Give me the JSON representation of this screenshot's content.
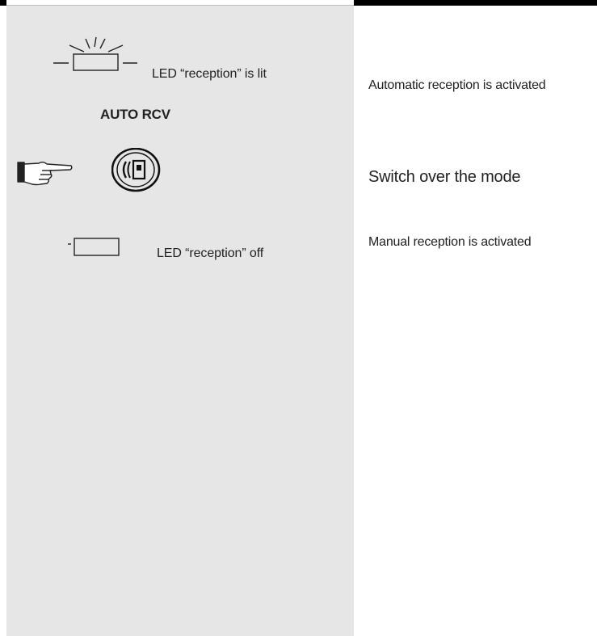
{
  "steps": [
    {
      "left_text": "LED “reception” is lit",
      "right_text": "Automatic reception is activated"
    },
    {
      "key_label": "AUTO RCV",
      "right_text": "Switch over the mode"
    },
    {
      "left_text": "LED “reception” off",
      "right_text": "Manual reception is activated"
    }
  ],
  "icons": {
    "led_lit": "led-lit-icon",
    "pointing_hand": "pointing-hand-icon",
    "auto_rcv_key": "phone-key-icon",
    "led_off": "led-off-icon"
  },
  "colors": {
    "left_panel_bg": "#e6e6e6",
    "text": "#222222",
    "rule": "#000000"
  }
}
